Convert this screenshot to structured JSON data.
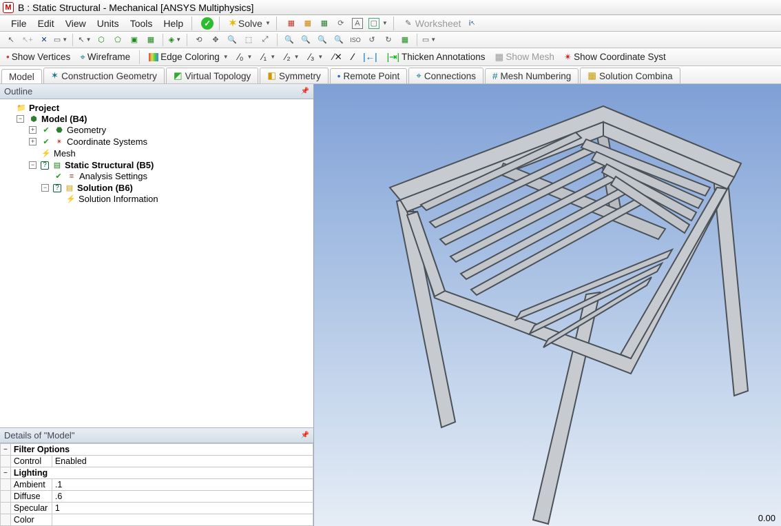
{
  "title": "B : Static Structural - Mechanical [ANSYS Multiphysics]",
  "menu": {
    "file": "File",
    "edit": "Edit",
    "view": "View",
    "units": "Units",
    "tools": "Tools",
    "help": "Help"
  },
  "toolbar1": {
    "solve": "Solve",
    "worksheet": "Worksheet"
  },
  "optrow": {
    "show_vertices": "Show Vertices",
    "wireframe": "Wireframe",
    "edge_coloring": "Edge Coloring",
    "thicken": "Thicken Annotations",
    "show_mesh": "Show Mesh",
    "show_coord": "Show Coordinate Syst"
  },
  "tabs": {
    "model": "Model",
    "construction": "Construction Geometry",
    "virtual": "Virtual Topology",
    "symmetry": "Symmetry",
    "remote": "Remote Point",
    "connections": "Connections",
    "meshnum": "Mesh Numbering",
    "solcomb": "Solution Combina"
  },
  "panes": {
    "outline": "Outline",
    "details": "Details of \"Model\""
  },
  "tree": {
    "project": "Project",
    "model": "Model (B4)",
    "geometry": "Geometry",
    "coord": "Coordinate Systems",
    "mesh": "Mesh",
    "static": "Static Structural (B5)",
    "analysis": "Analysis Settings",
    "solution": "Solution (B6)",
    "solinfo": "Solution Information"
  },
  "details": {
    "filter_group": "Filter Options",
    "control_k": "Control",
    "control_v": "Enabled",
    "light_group": "Lighting",
    "ambient_k": "Ambient",
    "ambient_v": ".1",
    "diffuse_k": "Diffuse",
    "diffuse_v": ".6",
    "specular_k": "Specular",
    "specular_v": "1",
    "color_k": "Color",
    "color_v": ""
  },
  "viewport": {
    "readout": "0.00"
  }
}
